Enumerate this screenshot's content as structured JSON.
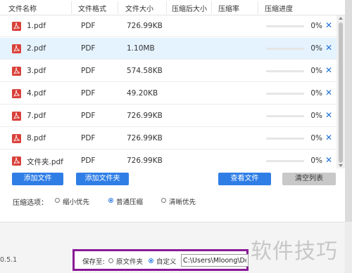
{
  "table": {
    "headers": [
      "文件名称",
      "文件格式",
      "文件大小",
      "压缩后大小",
      "压缩率",
      "压缩进度"
    ],
    "rows": [
      {
        "name": "1.pdf",
        "format": "PDF",
        "size": "726.99KB",
        "compressed_size": "",
        "ratio": "",
        "progress": "0%",
        "progress_value": 0,
        "selected": false
      },
      {
        "name": "2.pdf",
        "format": "PDF",
        "size": "1.10MB",
        "compressed_size": "",
        "ratio": "",
        "progress": "0%",
        "progress_value": 0,
        "selected": true
      },
      {
        "name": "3.pdf",
        "format": "PDF",
        "size": "574.58KB",
        "compressed_size": "",
        "ratio": "",
        "progress": "0%",
        "progress_value": 0,
        "selected": false
      },
      {
        "name": "4.pdf",
        "format": "PDF",
        "size": "49.20KB",
        "compressed_size": "",
        "ratio": "",
        "progress": "0%",
        "progress_value": 0,
        "selected": false
      },
      {
        "name": "7.pdf",
        "format": "PDF",
        "size": "726.99KB",
        "compressed_size": "",
        "ratio": "",
        "progress": "0%",
        "progress_value": 0,
        "selected": false
      },
      {
        "name": "8.pdf",
        "format": "PDF",
        "size": "726.99KB",
        "compressed_size": "",
        "ratio": "",
        "progress": "0%",
        "progress_value": 0,
        "selected": false
      },
      {
        "name": "文件夹.pdf",
        "format": "PDF",
        "size": "726.99KB",
        "compressed_size": "",
        "ratio": "",
        "progress": "0%",
        "progress_value": 0,
        "selected": false
      }
    ],
    "remove_glyph": "✕",
    "file_icon": "pdf-file-icon"
  },
  "buttons": {
    "add_file": "添加文件",
    "add_folder": "添加文件夹",
    "view_files": "查看文件",
    "clear_list": "清空列表"
  },
  "compression": {
    "label": "压缩选项：",
    "options": [
      {
        "label": "缩小优先",
        "checked": false
      },
      {
        "label": "普通压缩",
        "checked": true
      },
      {
        "label": "清晰优先",
        "checked": false
      }
    ]
  },
  "footer": {
    "version": "0.5.1",
    "save_to_label": "保存至:",
    "save_options": [
      {
        "label": "原文件夹",
        "checked": false
      },
      {
        "label": "自定义",
        "checked": true
      }
    ],
    "path_value": "C:\\Users\\Mloong\\Do"
  },
  "watermark": "软件技巧",
  "colors": {
    "accent": "#2f7ee6",
    "selected_row": "#e5f3ff",
    "highlight_border": "#8a1a96",
    "pdf_red": "#d9413a"
  }
}
